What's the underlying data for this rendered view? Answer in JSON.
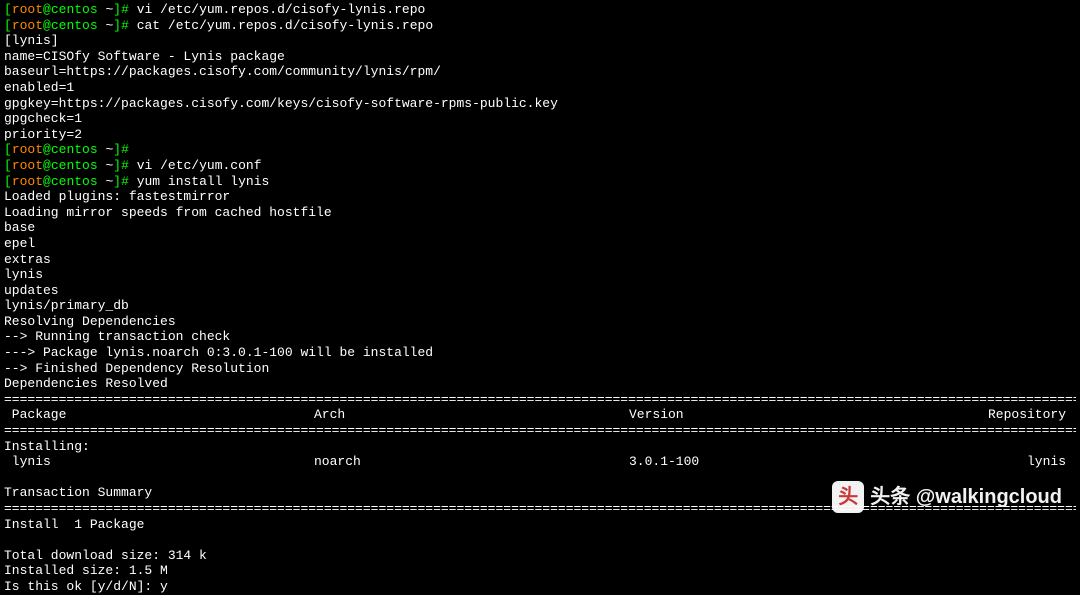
{
  "prompts": [
    {
      "user": "root",
      "host": "centos",
      "dir": "~",
      "cmd": "vi /etc/yum.repos.d/cisofy-lynis.repo"
    },
    {
      "user": "root",
      "host": "centos",
      "dir": "~",
      "cmd": "cat /etc/yum.repos.d/cisofy-lynis.repo"
    }
  ],
  "repo_file": {
    "section": "[lynis]",
    "lines": [
      "name=CISOfy Software - Lynis package",
      "baseurl=https://packages.cisofy.com/community/lynis/rpm/",
      "enabled=1",
      "gpgkey=https://packages.cisofy.com/keys/cisofy-software-rpms-public.key",
      "gpgcheck=1",
      "priority=2"
    ]
  },
  "prompts2": [
    {
      "user": "root",
      "host": "centos",
      "dir": "~",
      "cmd": ""
    },
    {
      "user": "root",
      "host": "centos",
      "dir": "~",
      "cmd": "vi /etc/yum.conf"
    },
    {
      "user": "root",
      "host": "centos",
      "dir": "~",
      "cmd": "yum install lynis"
    }
  ],
  "yum_output": [
    "Loaded plugins: fastestmirror",
    "Loading mirror speeds from cached hostfile",
    "base",
    "epel",
    "extras",
    "lynis",
    "updates",
    "lynis/primary_db",
    "Resolving Dependencies",
    "--> Running transaction check",
    "---> Package lynis.noarch 0:3.0.1-100 will be installed",
    "--> Finished Dependency Resolution",
    "",
    "Dependencies Resolved",
    ""
  ],
  "rule": "=================================================================================================================================================================",
  "headers": {
    "package": " Package",
    "arch": "Arch",
    "version": "Version",
    "repository": "Repository"
  },
  "installing_label": "Installing:",
  "install_row": {
    "package": " lynis",
    "arch": "noarch",
    "version": "3.0.1-100",
    "repository": "lynis"
  },
  "transaction_summary": "Transaction Summary",
  "install_summary": "Install  1 Package",
  "download_size": "Total download size: 314 k",
  "installed_size": "Installed size: 1.5 M",
  "confirm_prompt": "Is this ok [y/d/N]: ",
  "confirm_answer": "y",
  "watermark": {
    "icon_text": "头",
    "text": "头条 @walkingcloud"
  }
}
